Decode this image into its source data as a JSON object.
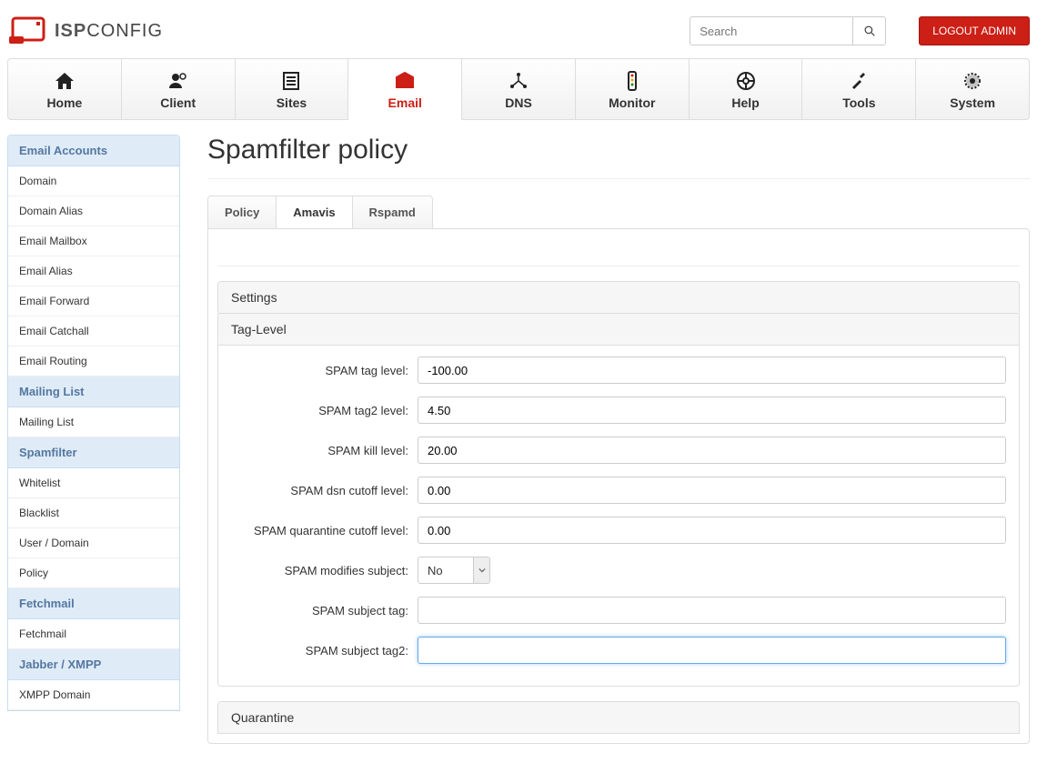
{
  "header": {
    "brand_bold": "ISP",
    "brand_light": "CONFIG",
    "search_placeholder": "Search",
    "logout_label": "LOGOUT ADMIN"
  },
  "mainnav": [
    {
      "label": "Home"
    },
    {
      "label": "Client"
    },
    {
      "label": "Sites"
    },
    {
      "label": "Email"
    },
    {
      "label": "DNS"
    },
    {
      "label": "Monitor"
    },
    {
      "label": "Help"
    },
    {
      "label": "Tools"
    },
    {
      "label": "System"
    }
  ],
  "sidebar": {
    "groups": {
      "accounts": {
        "header": "Email Accounts",
        "items": [
          "Domain",
          "Domain Alias",
          "Email Mailbox",
          "Email Alias",
          "Email Forward",
          "Email Catchall",
          "Email Routing"
        ]
      },
      "mailing": {
        "header": "Mailing List",
        "items": [
          "Mailing List"
        ]
      },
      "spam": {
        "header": "Spamfilter",
        "items": [
          "Whitelist",
          "Blacklist",
          "User / Domain",
          "Policy"
        ]
      },
      "fetch": {
        "header": "Fetchmail",
        "items": [
          "Fetchmail"
        ]
      },
      "jabber": {
        "header": "Jabber / XMPP",
        "items": [
          "XMPP Domain"
        ]
      }
    }
  },
  "page": {
    "title": "Spamfilter policy",
    "tabs": [
      "Policy",
      "Amavis",
      "Rspamd"
    ],
    "settings_header": "Settings",
    "taglevel_header": "Tag-Level",
    "quarantine_header": "Quarantine",
    "fields": {
      "spam_tag_level": {
        "label": "SPAM tag level:",
        "value": "-100.00"
      },
      "spam_tag2_level": {
        "label": "SPAM tag2 level:",
        "value": "4.50"
      },
      "spam_kill_level": {
        "label": "SPAM kill level:",
        "value": "20.00"
      },
      "spam_dsn_cutoff": {
        "label": "SPAM dsn cutoff level:",
        "value": "0.00"
      },
      "spam_quarantine_cutoff": {
        "label": "SPAM quarantine cutoff level:",
        "value": "0.00"
      },
      "spam_modifies_subject": {
        "label": "SPAM modifies subject:",
        "value": "No"
      },
      "spam_subject_tag": {
        "label": "SPAM subject tag:",
        "value": ""
      },
      "spam_subject_tag2": {
        "label": "SPAM subject tag2:",
        "value": ""
      }
    }
  }
}
